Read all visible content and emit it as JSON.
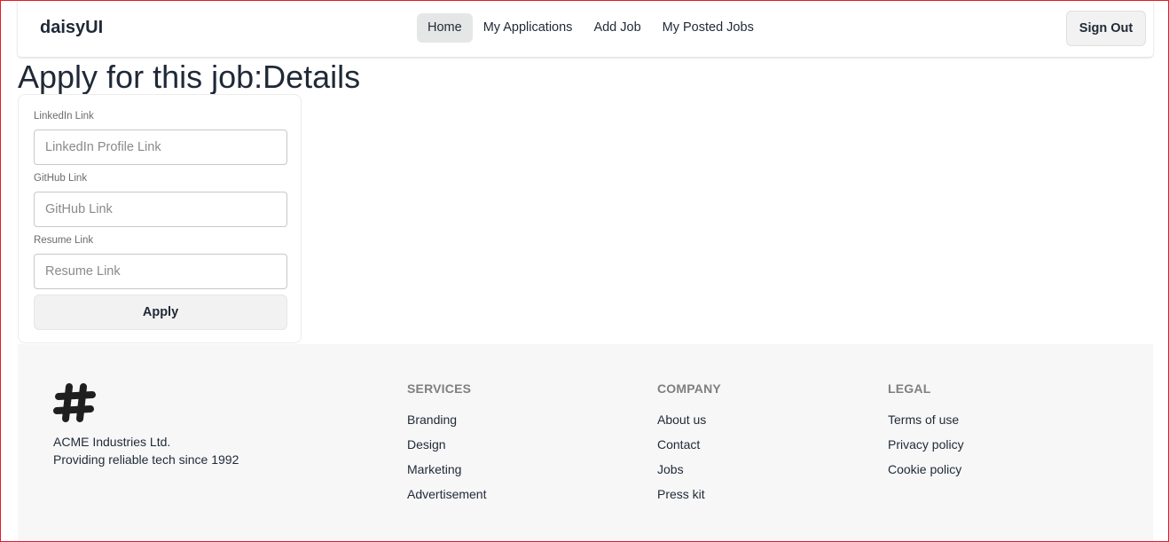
{
  "navbar": {
    "brand": "daisyUI",
    "menu": [
      "Home",
      "My Applications",
      "Add Job",
      "My Posted Jobs"
    ],
    "signout_label": "Sign Out"
  },
  "page": {
    "title": "Apply for this job:Details"
  },
  "form": {
    "linkedin_label": "LinkedIn Link",
    "linkedin_placeholder": "LinkedIn Profile Link",
    "linkedin_value": "",
    "github_label": "GitHub Link",
    "github_placeholder": "GitHub Link",
    "github_value": "",
    "resume_label": "Resume Link",
    "resume_placeholder": "Resume Link",
    "resume_value": "",
    "apply_label": "Apply"
  },
  "footer": {
    "company_name": "ACME Industries Ltd.",
    "tagline": "Providing reliable tech since 1992",
    "logo_icon": "hashtag-logo-icon",
    "services": {
      "title": "SERVICES",
      "links": [
        "Branding",
        "Design",
        "Marketing",
        "Advertisement"
      ]
    },
    "company": {
      "title": "COMPANY",
      "links": [
        "About us",
        "Contact",
        "Jobs",
        "Press kit"
      ]
    },
    "legal": {
      "title": "LEGAL",
      "links": [
        "Terms of use",
        "Privacy policy",
        "Cookie policy"
      ]
    }
  }
}
